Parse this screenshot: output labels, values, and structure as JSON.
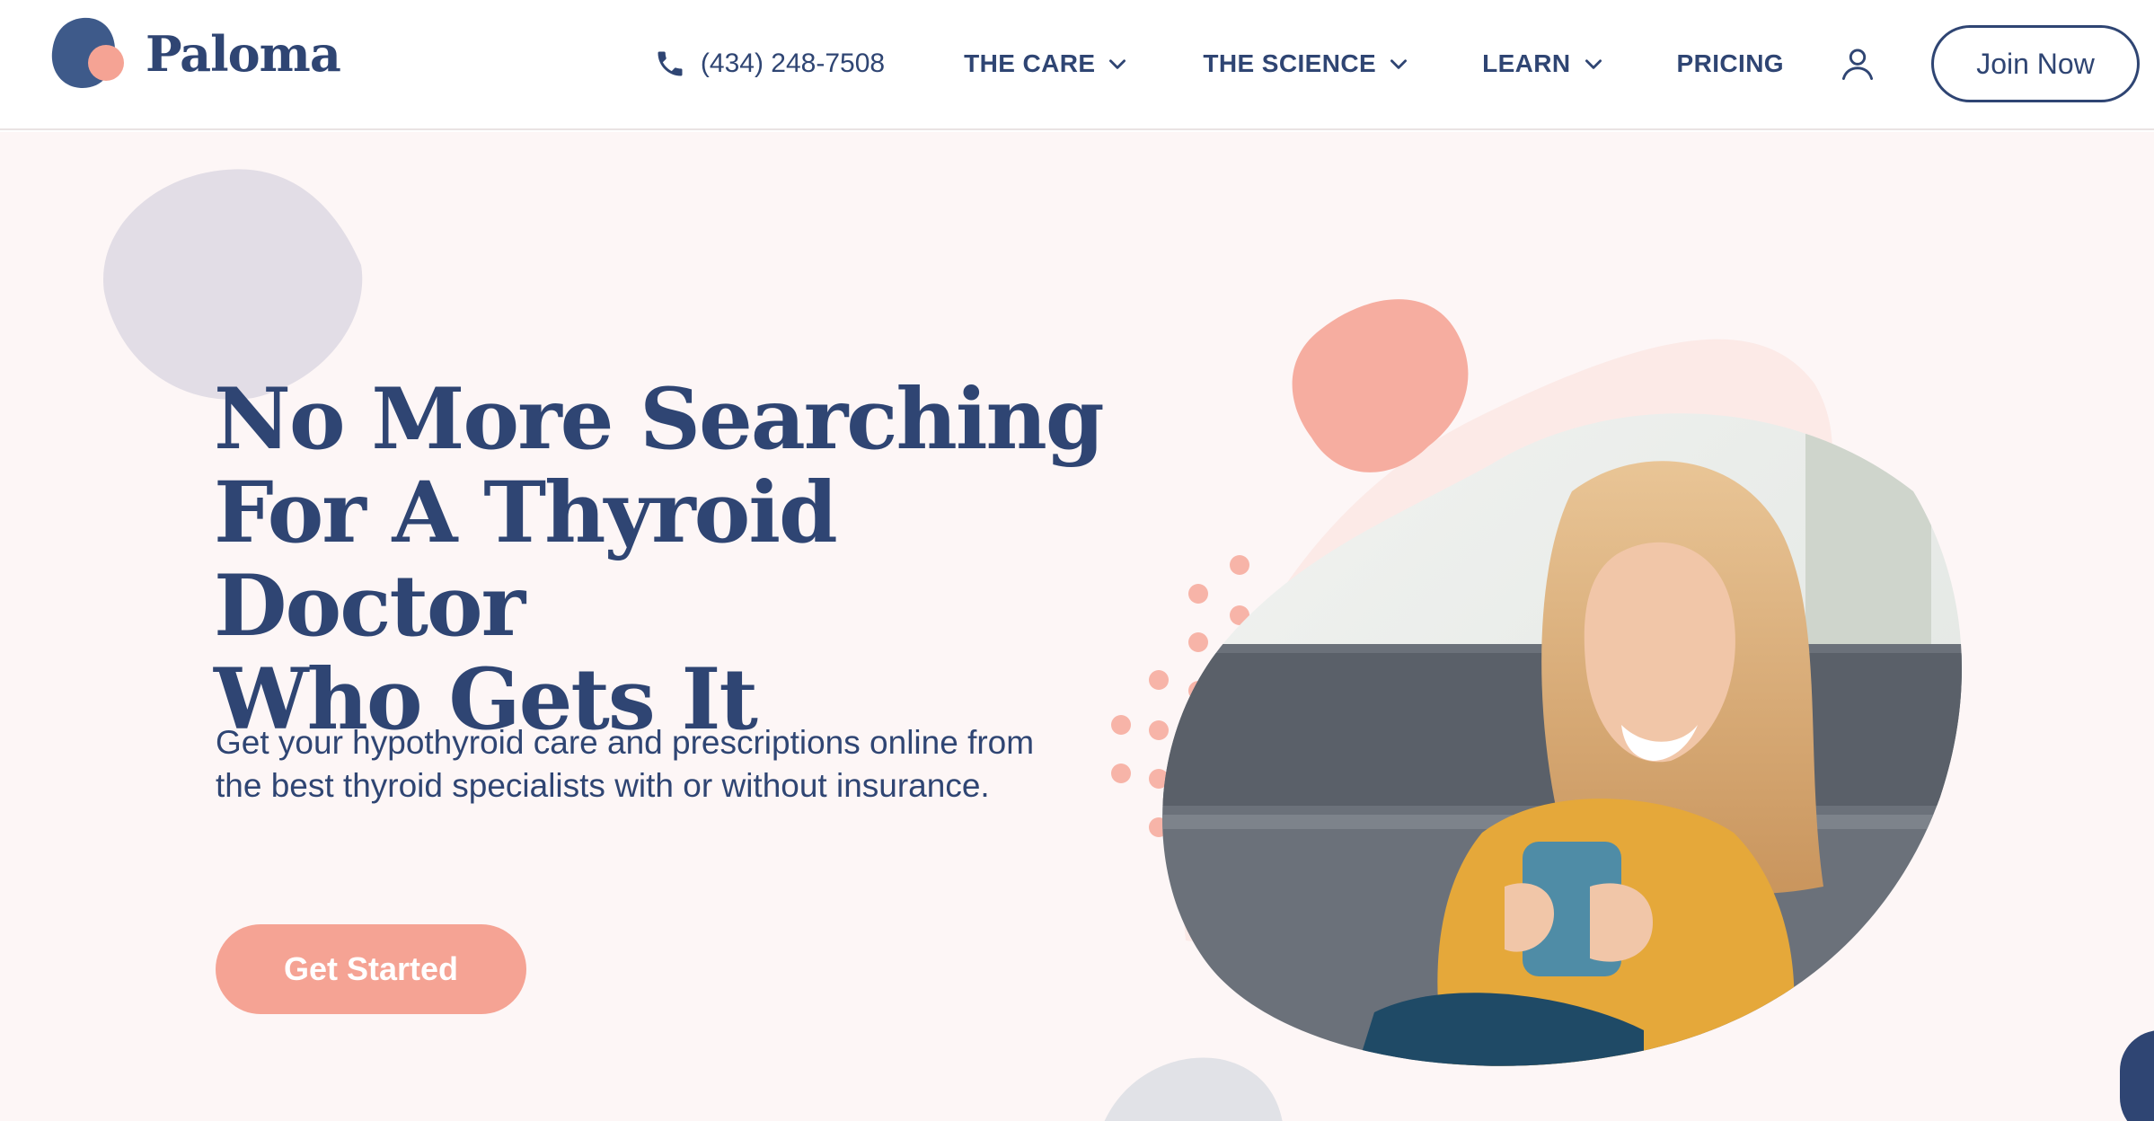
{
  "brand": {
    "name": "Paloma",
    "colors": {
      "navy": "#2f4573",
      "coral": "#f5a394",
      "blush": "#fdf6f6",
      "lilac": "#e3dee6"
    }
  },
  "nav": {
    "phone": "(434) 248-7508",
    "items": [
      {
        "label": "THE CARE",
        "has_dropdown": true
      },
      {
        "label": "THE SCIENCE",
        "has_dropdown": true
      },
      {
        "label": "LEARN",
        "has_dropdown": true
      },
      {
        "label": "PRICING",
        "has_dropdown": false
      }
    ],
    "account_icon": "user-icon",
    "join_label": "Join Now"
  },
  "hero": {
    "title_lines": [
      "No More Searching",
      "For A Thyroid Doctor",
      "Who Gets It"
    ],
    "subtitle": "Get your hypothyroid care and prescriptions online from the best thyroid specialists with or without insurance.",
    "cta_label": "Get Started"
  }
}
